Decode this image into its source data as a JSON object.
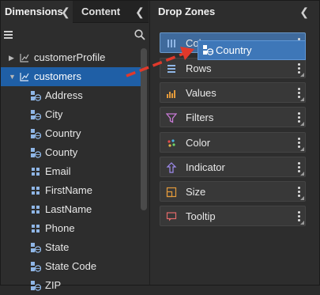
{
  "left_panel": {
    "tabs": [
      {
        "label": "Dimensions",
        "active": true
      },
      {
        "label": "Content",
        "active": false
      }
    ],
    "tree": [
      {
        "label": "customerProfile",
        "expanded": false,
        "selected": false
      },
      {
        "label": "customers",
        "expanded": true,
        "selected": true
      }
    ],
    "fields": [
      {
        "label": "Address",
        "icon": "globe-field-icon"
      },
      {
        "label": "City",
        "icon": "globe-field-icon"
      },
      {
        "label": "Country",
        "icon": "globe-field-icon"
      },
      {
        "label": "County",
        "icon": "globe-field-icon"
      },
      {
        "label": "Email",
        "icon": "text-field-icon"
      },
      {
        "label": "FirstName",
        "icon": "text-field-icon"
      },
      {
        "label": "LastName",
        "icon": "text-field-icon"
      },
      {
        "label": "Phone",
        "icon": "text-field-icon"
      },
      {
        "label": "State",
        "icon": "globe-field-icon"
      },
      {
        "label": "State Code",
        "icon": "globe-field-icon"
      },
      {
        "label": "ZIP",
        "icon": "globe-field-icon"
      }
    ]
  },
  "right_panel": {
    "title": "Drop Zones",
    "zones": [
      {
        "label": "Columns",
        "icon": "columns-icon",
        "active": true
      },
      {
        "label": "Rows",
        "icon": "rows-icon",
        "active": false
      },
      {
        "label": "Values",
        "icon": "values-icon",
        "active": false
      },
      {
        "label": "Filters",
        "icon": "filter-icon",
        "active": false
      },
      {
        "label": "Color",
        "icon": "color-icon",
        "active": false
      },
      {
        "label": "Indicator",
        "icon": "indicator-icon",
        "active": false
      },
      {
        "label": "Size",
        "icon": "size-icon",
        "active": false
      },
      {
        "label": "Tooltip",
        "icon": "tooltip-icon",
        "active": false
      }
    ]
  },
  "drag": {
    "label": "Country",
    "icon": "globe-field-icon"
  },
  "colors": {
    "selection": "#1f5fa6",
    "drag_arrow": "#e0392b",
    "drag_chip": "#3e77b8"
  }
}
